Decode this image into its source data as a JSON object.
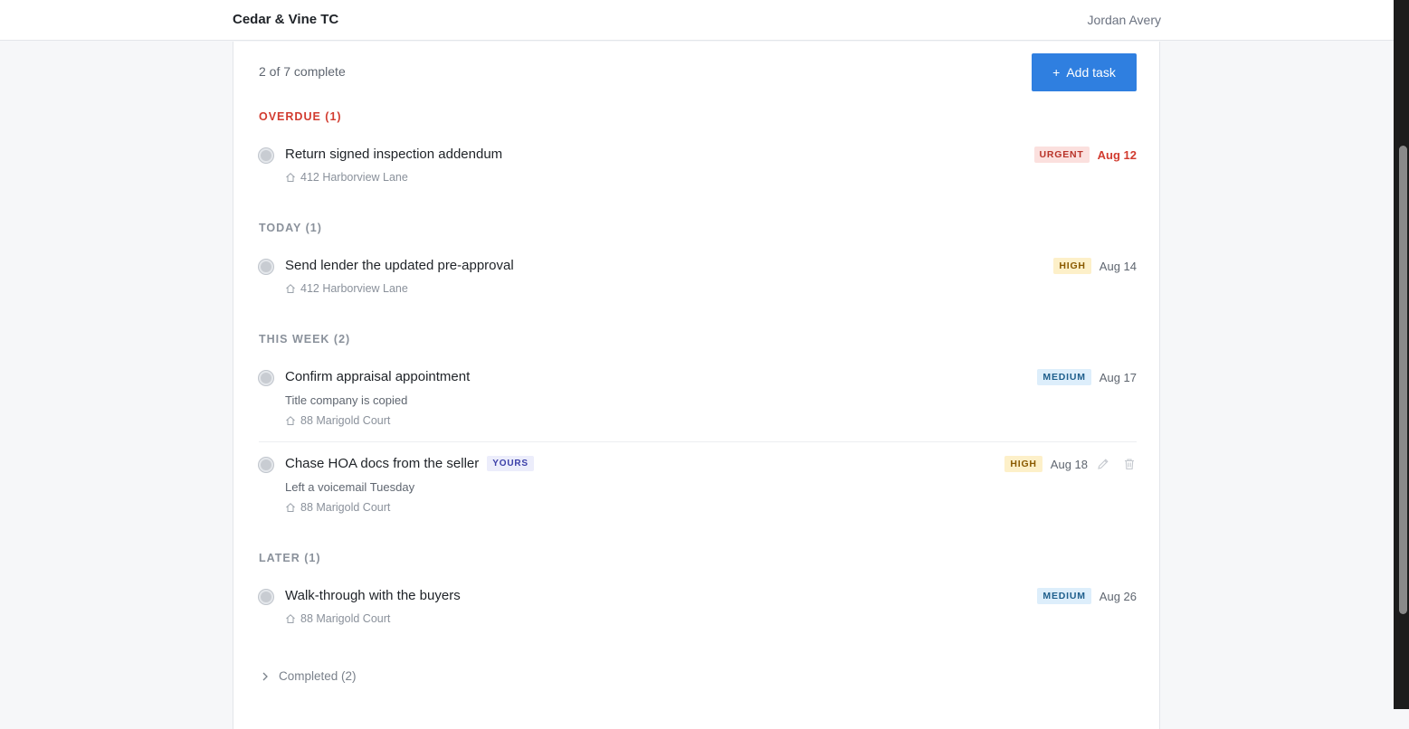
{
  "header": {
    "brand": "Cedar & Vine TC",
    "user_name": "Jordan Avery"
  },
  "toolbar": {
    "progress": "2 of 7 complete",
    "add_task_label": "Add task",
    "add_task_icon": "plus"
  },
  "sections": [
    {
      "title": "OVERDUE (1)",
      "tasks": [
        {
          "title": "Return signed inspection addendum",
          "address": "412 Harborview Lane",
          "priority": "URGENT",
          "due": "Aug 12"
        }
      ]
    },
    {
      "title": "TODAY (1)",
      "tasks": [
        {
          "title": "Send lender the updated pre-approval",
          "address": "412 Harborview Lane",
          "priority": "HIGH",
          "due": "Aug 14"
        }
      ]
    },
    {
      "title": "THIS WEEK (2)",
      "tasks": [
        {
          "title": "Confirm appraisal appointment",
          "note": "Title company is copied",
          "address": "88 Marigold Court",
          "priority": "MEDIUM",
          "due": "Aug 17"
        },
        {
          "title": "Chase HOA docs from the seller",
          "tag": "YOURS",
          "note": "Left a voicemail Tuesday",
          "address": "88 Marigold Court",
          "priority": "HIGH",
          "due": "Aug 18"
        }
      ]
    },
    {
      "title": "LATER (1)",
      "tasks": [
        {
          "title": "Walk-through with the buyers",
          "address": "88 Marigold Court",
          "priority": "MEDIUM",
          "due": "Aug 26"
        }
      ]
    }
  ],
  "completed_toggle": "Completed (2)",
  "colors": {
    "accent": "#2f7fe0",
    "overdue": "#d23c30",
    "urgent_bg": "#fbe0de",
    "high_bg": "#fdf0c9",
    "medium_bg": "#ddeefb",
    "yours_bg": "#ecedfb"
  },
  "icons": {
    "address": "house-icon",
    "edit": "pencil-icon",
    "delete": "trash-icon",
    "expand": "chevron-right-icon",
    "check": "circle-checkbox-icon"
  }
}
